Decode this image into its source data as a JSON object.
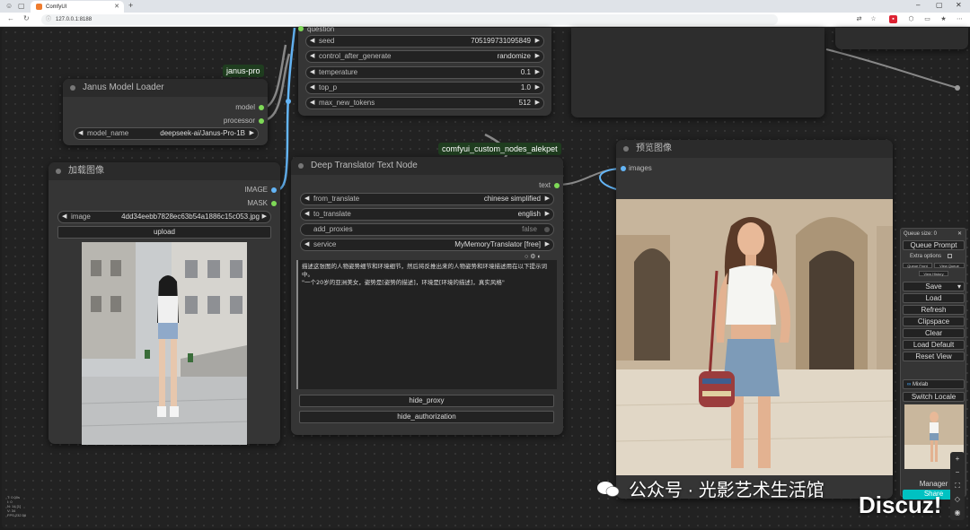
{
  "browser": {
    "tab_title": "ComfyUI",
    "new_tab": "+",
    "url": "127.0.0.1:8188"
  },
  "canvas": {
    "group_tags": {
      "janus": "janus-pro",
      "translator": "comfyui_custom_nodes_alekpet"
    }
  },
  "sampler_node": {
    "top_label": "question",
    "widgets": [
      {
        "label": "seed",
        "value": "705199731095849"
      },
      {
        "label": "control_after_generate",
        "value": "randomize"
      },
      {
        "label": "temperature",
        "value": "0.1"
      },
      {
        "label": "top_p",
        "value": "1.0"
      },
      {
        "label": "max_new_tokens",
        "value": "512"
      }
    ]
  },
  "janus_loader": {
    "title": "Janus Model Loader",
    "outputs": [
      "model",
      "processor"
    ],
    "widget": {
      "label": "model_name",
      "value": "deepseek-ai/Janus-Pro-1B"
    }
  },
  "load_image": {
    "title": "加载图像",
    "outputs": [
      "IMAGE",
      "MASK"
    ],
    "widget": {
      "label": "image",
      "value": "4dd34eebb7828ec63b54a1886c15c053.jpg"
    },
    "upload_label": "upload"
  },
  "translator": {
    "title": "Deep Translator Text Node",
    "output": "text",
    "widgets": [
      {
        "label": "from_translate",
        "value": "chinese simplified"
      },
      {
        "label": "to_translate",
        "value": "english"
      },
      {
        "label": "add_proxies",
        "value": "false"
      },
      {
        "label": "service",
        "value": "MyMemoryTranslator [free]"
      }
    ],
    "text_line1": "描述这张图的人物姿势细节和环境细节，然后将反推出来的人物姿势和环境描述用在以下提示词中。",
    "text_line2": "\"一个20岁的亚洲美女，姿势是[姿势的描述]，环境是[环境的描述]，真实风格\"",
    "buttons": [
      "hide_proxy",
      "hide_authorization"
    ]
  },
  "preview": {
    "title": "预览图像",
    "input": "images"
  },
  "menu": {
    "queue_size": "Queue size: 0",
    "queue_prompt": "Queue Prompt",
    "extra_options": "Extra options",
    "queue_front": "Queue Front",
    "view_queue": "View Queue",
    "view_history": "View History",
    "buttons": [
      "Save",
      "Load",
      "Refresh",
      "Clipspace",
      "Clear",
      "Load Default",
      "Reset View"
    ],
    "mixlab": "Mixlab",
    "switch_locale": "Switch Locale",
    "manager": "Manager",
    "share": "Share"
  },
  "stats": {
    "l1": "T: 0.00s",
    "l2": "I: 0",
    "l3": "N: 14 [1]",
    "l4": "V: 34",
    "l5": "FPS:232.56"
  },
  "watermark": {
    "wechat": "公众号 · 光影艺术生活馆",
    "discuz": "Discuz!"
  },
  "colors": {
    "link_blue": "#64b5f6",
    "slot_green": "#7ed957",
    "share_cyan": "#00c2c2"
  }
}
